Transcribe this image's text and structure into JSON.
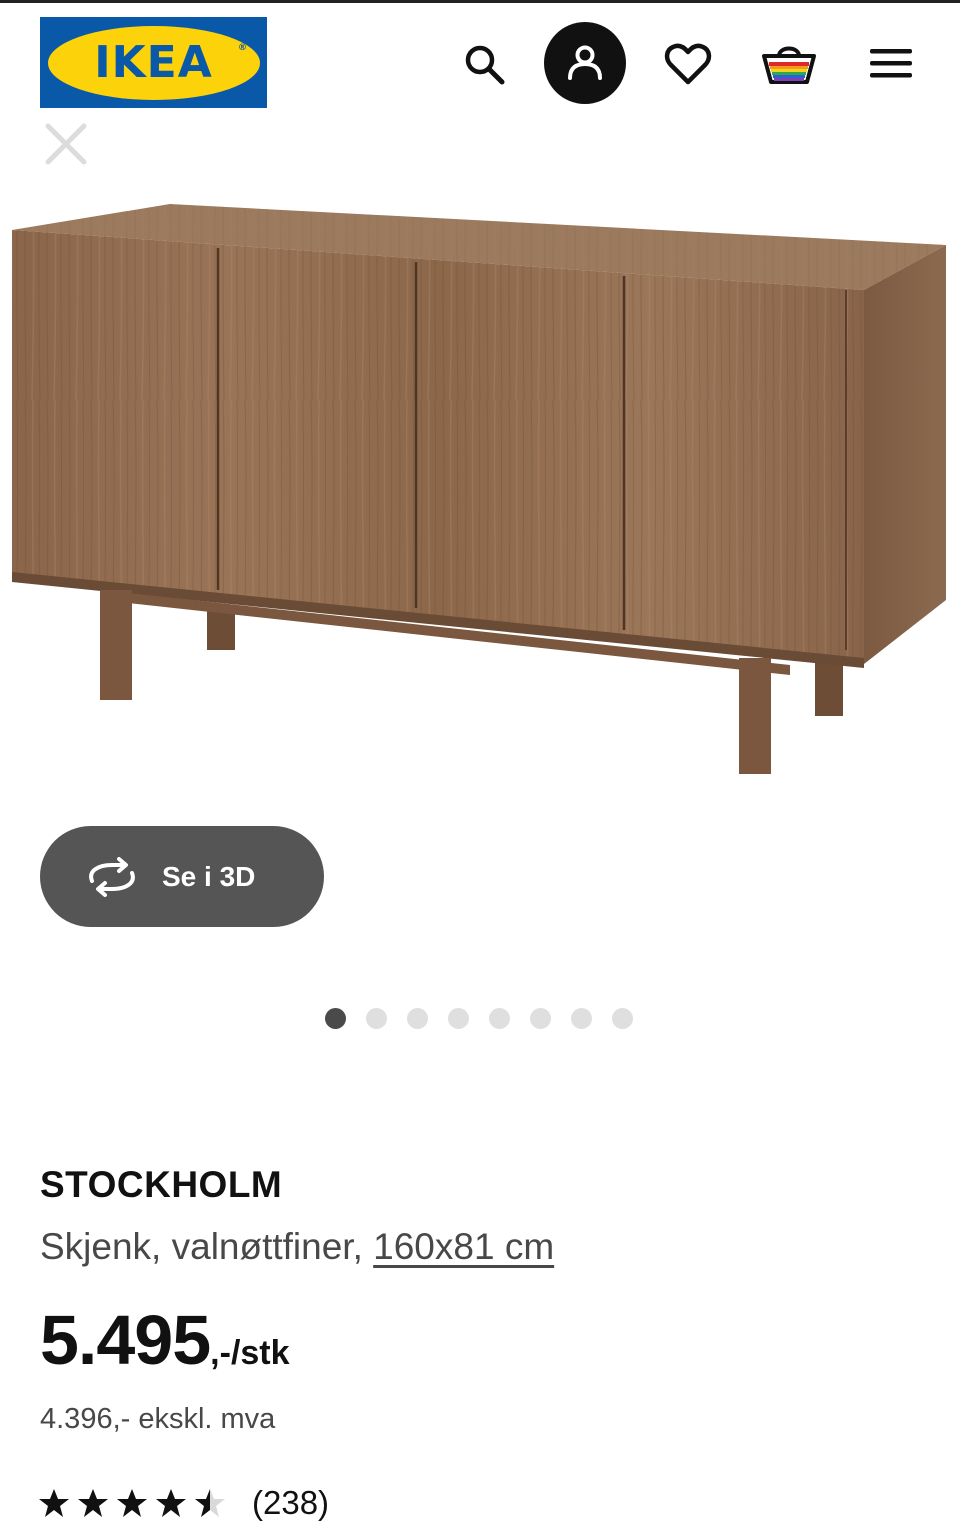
{
  "brand": {
    "logo_text": "IKEA",
    "colors": {
      "blue": "#0a58a8",
      "yellow": "#fcd20a"
    }
  },
  "header": {
    "icons": [
      "search-icon",
      "account-icon",
      "heart-icon",
      "basket-icon",
      "menu-icon"
    ]
  },
  "gallery": {
    "view_3d_label": "Se i 3D",
    "total_images": 8,
    "active_image_index": 0
  },
  "product": {
    "name": "STOCKHOLM",
    "description": "Skjenk, valnøttfiner,",
    "dimensions": "160x81 cm",
    "price_main": "5.495",
    "price_suffix": ",-/stk",
    "price_ex_vat": "4.396,- ekskl. mva",
    "rating_value": 4.5,
    "rating_max": 5,
    "review_count": "(238)"
  }
}
